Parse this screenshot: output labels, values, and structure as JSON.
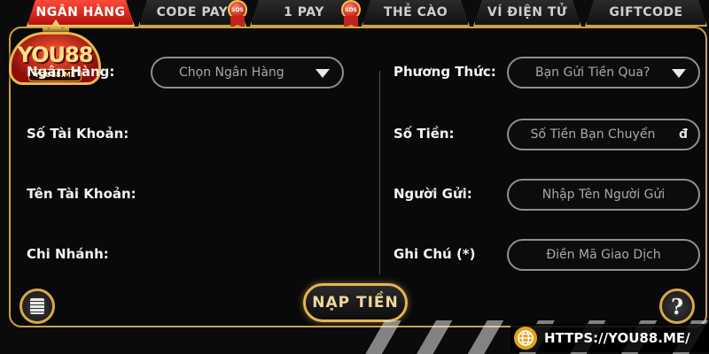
{
  "tabs": [
    {
      "label": "NGÂN HÀNG",
      "active": true
    },
    {
      "label": "CODE PAY",
      "active": false
    },
    {
      "label": "1 PAY",
      "active": false
    },
    {
      "label": "THẺ CÀO",
      "active": false
    },
    {
      "label": "VÍ ĐIỆN TỬ",
      "active": false
    },
    {
      "label": "GIFTCODE",
      "active": false
    }
  ],
  "badges": [
    "gift-badge-icon",
    "gift-badge-icon"
  ],
  "logo": {
    "brand": "YOU88",
    "domain": "YOU88.ME"
  },
  "left_form": {
    "bank_label": "Ngân Hàng:",
    "bank_select": "Chọn Ngân Hàng",
    "account_number_label": "Số Tài Khoản:",
    "account_name_label": "Tên Tài Khoản:",
    "branch_label": "Chi Nhánh:"
  },
  "right_form": {
    "method_label": "Phương Thức:",
    "method_select": "Bạn Gửi Tiền Qua?",
    "amount_label": "Số Tiền:",
    "amount_placeholder": "Số Tiền Bạn Chuyển",
    "amount_unit": "đ",
    "sender_label": "Người Gửi:",
    "sender_placeholder": "Nhập Tên Người Gửi",
    "note_label": "Ghi Chú (*)",
    "note_placeholder": "Điền Mã Giao Dịch"
  },
  "actions": {
    "deposit_label": "NẠP TIỀN",
    "help_label": "?"
  },
  "footer": {
    "url": "HTTPS://YOU88.ME/"
  },
  "colors": {
    "gold": "#c9a14a",
    "active_tab": "#d8281c",
    "url_icon": "#e5a21c"
  }
}
